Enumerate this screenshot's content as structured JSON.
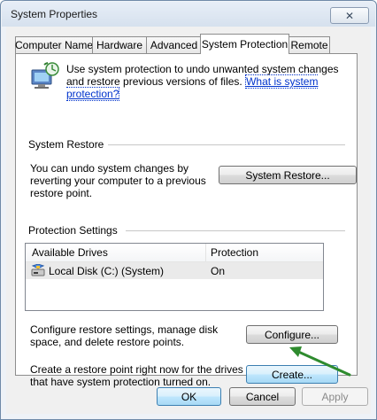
{
  "window": {
    "title": "System Properties",
    "close_glyph": "✕"
  },
  "tabs": [
    {
      "label": "Computer Name"
    },
    {
      "label": "Hardware"
    },
    {
      "label": "Advanced"
    },
    {
      "label": "System Protection"
    },
    {
      "label": "Remote"
    }
  ],
  "intro": {
    "text": "Use system protection to undo unwanted system changes and restore previous versions of files.",
    "link": "What is system protection?",
    "icon": "system-protection-icon"
  },
  "system_restore": {
    "heading": "System Restore",
    "description": "You can undo system changes by reverting your computer to a previous restore point.",
    "button": "System Restore..."
  },
  "protection_settings": {
    "heading": "Protection Settings",
    "columns": [
      "Available Drives",
      "Protection"
    ],
    "rows": [
      {
        "drive": "Local Disk (C:) (System)",
        "protection": "On",
        "icon": "drive-icon"
      }
    ],
    "configure_text": "Configure restore settings, manage disk space, and delete restore points.",
    "configure_button": "Configure...",
    "create_text": "Create a restore point right now for the drives that have system protection turned on.",
    "create_button": "Create..."
  },
  "footer": {
    "ok": "OK",
    "cancel": "Cancel",
    "apply": "Apply"
  },
  "colors": {
    "link": "#0033cc",
    "annotation_arrow": "#2e8b2e",
    "focus_border": "#3c7fb1"
  }
}
